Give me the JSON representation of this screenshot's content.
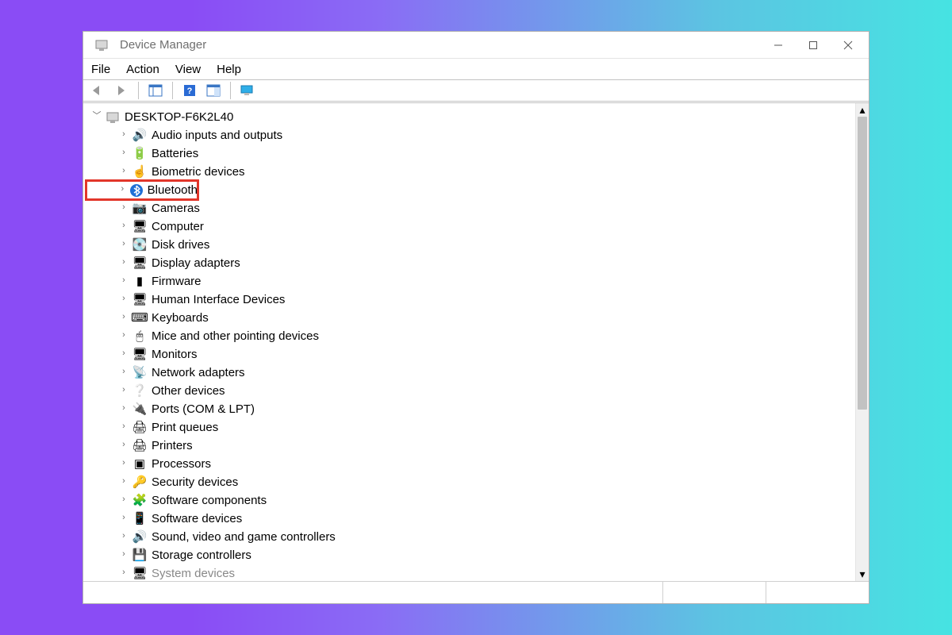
{
  "window": {
    "title": "Device Manager",
    "menus": [
      "File",
      "Action",
      "View",
      "Help"
    ]
  },
  "toolbar": {
    "back": "Back",
    "forward": "Forward",
    "showhide": "Show/Hide console tree",
    "help": "Help",
    "properties": "Properties",
    "monitors": "Monitors"
  },
  "root": {
    "name": "DESKTOP-F6K2L40"
  },
  "categories": [
    {
      "label": "Audio inputs and outputs",
      "icon": "🔊"
    },
    {
      "label": "Batteries",
      "icon": "🔋"
    },
    {
      "label": "Biometric devices",
      "icon": "☝"
    },
    {
      "label": "Bluetooth",
      "icon": "BT",
      "highlight": true
    },
    {
      "label": "Cameras",
      "icon": "📷"
    },
    {
      "label": "Computer",
      "icon": "🖥"
    },
    {
      "label": "Disk drives",
      "icon": "💽"
    },
    {
      "label": "Display adapters",
      "icon": "🖥"
    },
    {
      "label": "Firmware",
      "icon": "▮"
    },
    {
      "label": "Human Interface Devices",
      "icon": "🖥"
    },
    {
      "label": "Keyboards",
      "icon": "⌨"
    },
    {
      "label": "Mice and other pointing devices",
      "icon": "🖱"
    },
    {
      "label": "Monitors",
      "icon": "🖥"
    },
    {
      "label": "Network adapters",
      "icon": "📡"
    },
    {
      "label": "Other devices",
      "icon": "❔"
    },
    {
      "label": "Ports (COM & LPT)",
      "icon": "🔌"
    },
    {
      "label": "Print queues",
      "icon": "🖨"
    },
    {
      "label": "Printers",
      "icon": "🖨"
    },
    {
      "label": "Processors",
      "icon": "▣"
    },
    {
      "label": "Security devices",
      "icon": "🔑"
    },
    {
      "label": "Software components",
      "icon": "🧩"
    },
    {
      "label": "Software devices",
      "icon": "📱"
    },
    {
      "label": "Sound, video and game controllers",
      "icon": "🔊"
    },
    {
      "label": "Storage controllers",
      "icon": "💾"
    },
    {
      "label": "System devices",
      "icon": "🖥",
      "cut": true
    }
  ]
}
